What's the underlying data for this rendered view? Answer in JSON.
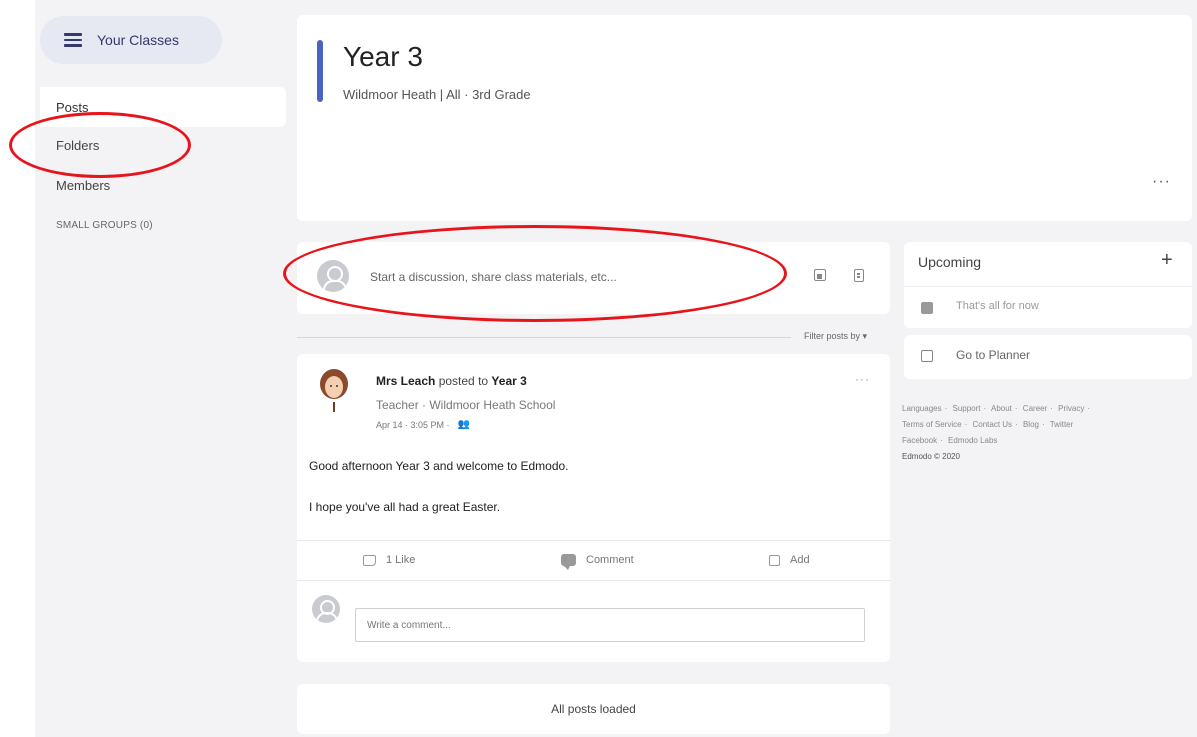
{
  "sidebar": {
    "classes_button": "Your Classes",
    "nav": {
      "posts": "Posts",
      "folders": "Folders",
      "members": "Members",
      "small_groups": "SMALL GROUPS (0)"
    }
  },
  "class_header": {
    "title": "Year 3",
    "subtitle": "Wildmoor Heath | All · 3rd Grade",
    "more": "···"
  },
  "composer": {
    "placeholder": "Start a discussion, share class materials, etc..."
  },
  "feed": {
    "filter_label": "Filter posts by ▾",
    "loaded": "All posts loaded"
  },
  "post": {
    "author": "Mrs Leach",
    "posted_to": "posted to",
    "class_name": "Year 3",
    "role": "Teacher · Wildmoor Heath School",
    "date": "Apr 14 · 3:05 PM ·",
    "audience_icon": "people-icon",
    "line1": "Good afternoon Year 3 and welcome to Edmodo.",
    "line2": "I hope you've all had a great Easter.",
    "more": "···",
    "actions": {
      "like": "1 Like",
      "comment": "Comment",
      "add": "Add"
    },
    "comment_placeholder": "Write a comment..."
  },
  "upcoming": {
    "title": "Upcoming",
    "add": "+",
    "empty": "That's all for now"
  },
  "planner": {
    "label": "Go to Planner"
  },
  "footer": {
    "links_row1": [
      "Languages",
      "Support",
      "About",
      "Career",
      "Privacy"
    ],
    "links_row2": [
      "Terms of Service",
      "Contact Us",
      "Blog",
      "Twitter"
    ],
    "links_row3": [
      "Facebook",
      "Edmodo Labs"
    ],
    "copyright": "Edmodo © 2020"
  },
  "colors": {
    "accent": "#4b64c2",
    "annotation": "#e8141b",
    "background": "#f3f3f5"
  }
}
